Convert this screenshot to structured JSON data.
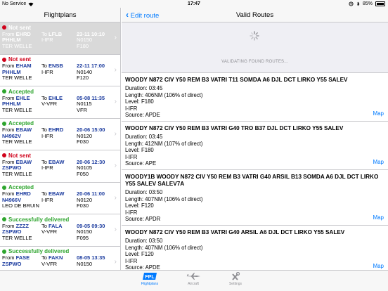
{
  "status_bar": {
    "carrier": "No Service",
    "time": "17:47",
    "battery": "85%"
  },
  "left_panel": {
    "title": "Flightplans",
    "items": [
      {
        "status": "Not sent",
        "status_color": "#d0021b",
        "from_label": "From",
        "from": "EHRD",
        "to_label": "To",
        "to": "LFLB",
        "date": "23-11 10:10",
        "reg": "PHHLM",
        "rules": "I-IFR",
        "speed": "N0150",
        "pilot": "TER WELLE",
        "level": "F180",
        "selected": true
      },
      {
        "status": "Not sent",
        "status_color": "#d0021b",
        "from_label": "From",
        "from": "EHAM",
        "to_label": "To",
        "to": "ENSB",
        "date": "22-11 17:00",
        "reg": "PHHLM",
        "rules": "I-IFR",
        "speed": "N0140",
        "pilot": "TER WELLE",
        "level": "F120",
        "selected": false
      },
      {
        "status": "Accepted",
        "status_color": "#2ea52e",
        "from_label": "From",
        "from": "EHLE",
        "to_label": "To",
        "to": "EHLE",
        "date": "05-08 11:35",
        "reg": "PHHLM",
        "rules": "V-VFR",
        "speed": "N0115",
        "pilot": "TER WELLE",
        "level": "VFR",
        "selected": false
      },
      {
        "status": "Accepted",
        "status_color": "#2ea52e",
        "from_label": "From",
        "from": "EBAW",
        "to_label": "To",
        "to": "EHRD",
        "date": "20-06 15:00",
        "reg": "N4962V",
        "rules": "I-IFR",
        "speed": "N0120",
        "pilot": "TER WELLE",
        "level": "F030",
        "selected": false
      },
      {
        "status": "Not sent",
        "status_color": "#d0021b",
        "from_label": "From",
        "from": "EBAW",
        "to_label": "To",
        "to": "EBAW",
        "date": "20-06 12:30",
        "reg": "ZSPWO",
        "rules": "I-IFR",
        "speed": "N0105",
        "pilot": "TER WELLE",
        "level": "F050",
        "selected": false
      },
      {
        "status": "Accepted",
        "status_color": "#2ea52e",
        "from_label": "From",
        "from": "EHRD",
        "to_label": "To",
        "to": "EBAW",
        "date": "20-06 11:00",
        "reg": "N4966V",
        "rules": "I-IFR",
        "speed": "N0120",
        "pilot": "LEO DE BRUIN",
        "level": "F030",
        "selected": false
      },
      {
        "status": "Successfully delivered",
        "status_color": "#2ea52e",
        "from_label": "From",
        "from": "ZZZZ",
        "to_label": "To",
        "to": "FALA",
        "date": "09-05 09:30",
        "reg": "ZSPWO",
        "rules": "V-VFR",
        "speed": "N0150",
        "pilot": "TER WELLE",
        "level": "F095",
        "selected": false
      },
      {
        "status": "Successfully delivered",
        "status_color": "#2ea52e",
        "from_label": "From",
        "from": "FASE",
        "to_label": "To",
        "to": "FAKN",
        "date": "08-05 13:35",
        "reg": "ZSPWO",
        "rules": "V-VFR",
        "speed": "N0150",
        "pilot": "",
        "level": "",
        "selected": false
      }
    ]
  },
  "right_panel": {
    "back_label": "Edit route",
    "title": "Valid Routes",
    "validating_text": "VALIDATING FOUND ROUTES...",
    "map_label": "Map",
    "routes": [
      {
        "title": "WOODY N872 CIV Y50 REM B3 VATRI T11 SOMDA A6 DJL DCT LIRKO Y55 SALEV",
        "duration": "Duration: 03:45",
        "length": "Length: 406NM (106% of direct)",
        "level": "Level: F180",
        "rules": "I-IFR",
        "source": "Source: APDE"
      },
      {
        "title": "WOODY N872 CIV Y50 REM B3 VATRI G40 TRO B37 DJL DCT LIRKO Y55 SALEV",
        "duration": "Duration: 03:45",
        "length": "Length: 412NM (107% of direct)",
        "level": "Level: F180",
        "rules": "I-IFR",
        "source": "Source: APE"
      },
      {
        "title": "WOODY1B WOODY N872 CIV Y50 REM B3 VATRI G40 ARSIL B13 SOMDA A6 DJL DCT LIRKO Y55 SALEV SALEV7A",
        "duration": "Duration: 03:50",
        "length": "Length: 407NM (106% of direct)",
        "level": "Level: F120",
        "rules": "I-IFR",
        "source": "Source: APDR"
      },
      {
        "title": "WOODY N872 CIV Y50 REM B3 VATRI G40 ARSIL A6 DJL DCT LIRKO Y55 SALEV",
        "duration": "Duration: 03:50",
        "length": "Length: 407NM (106% of direct)",
        "level": "Level: F120",
        "rules": "I-IFR",
        "source": "Source: APDE"
      }
    ]
  },
  "tab_bar": {
    "tabs": [
      {
        "label": "Flightplans",
        "icon": "fpl-icon",
        "active": true
      },
      {
        "label": "Aircraft",
        "icon": "airplane-icon",
        "active": false
      },
      {
        "label": "Settings",
        "icon": "tools-icon",
        "active": false
      }
    ]
  }
}
